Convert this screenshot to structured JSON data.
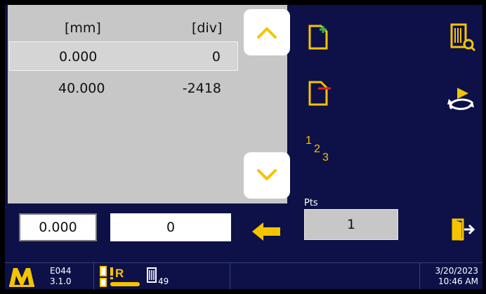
{
  "table": {
    "headers": [
      "[mm]",
      "[div]"
    ],
    "rows": [
      {
        "mm": "0.000",
        "div": "0"
      },
      {
        "mm": "40.000",
        "div": "-2418"
      }
    ]
  },
  "inputs": {
    "mm_value": "0.000",
    "div_value": "0"
  },
  "points": {
    "label": "Pts",
    "value": "1"
  },
  "icons": {
    "new_file": "new-file-icon",
    "delete_file": "delete-file-icon",
    "numbering": "numbering-icon",
    "view_file": "view-file-icon",
    "cycle": "cycle-icon",
    "exit": "exit-icon",
    "enter_arrow": "left-arrow-icon"
  },
  "numbering": {
    "one": "1",
    "two": "2",
    "three": "3"
  },
  "status_bar": {
    "device_code": "E044",
    "version": "3.1.0",
    "mode_letter": "R",
    "file_count": "49",
    "date": "3/20/2023",
    "time": "10:46 AM"
  },
  "colors": {
    "background": "#0d1147",
    "accent": "#f5c400",
    "panel": "#c8c7c7"
  }
}
